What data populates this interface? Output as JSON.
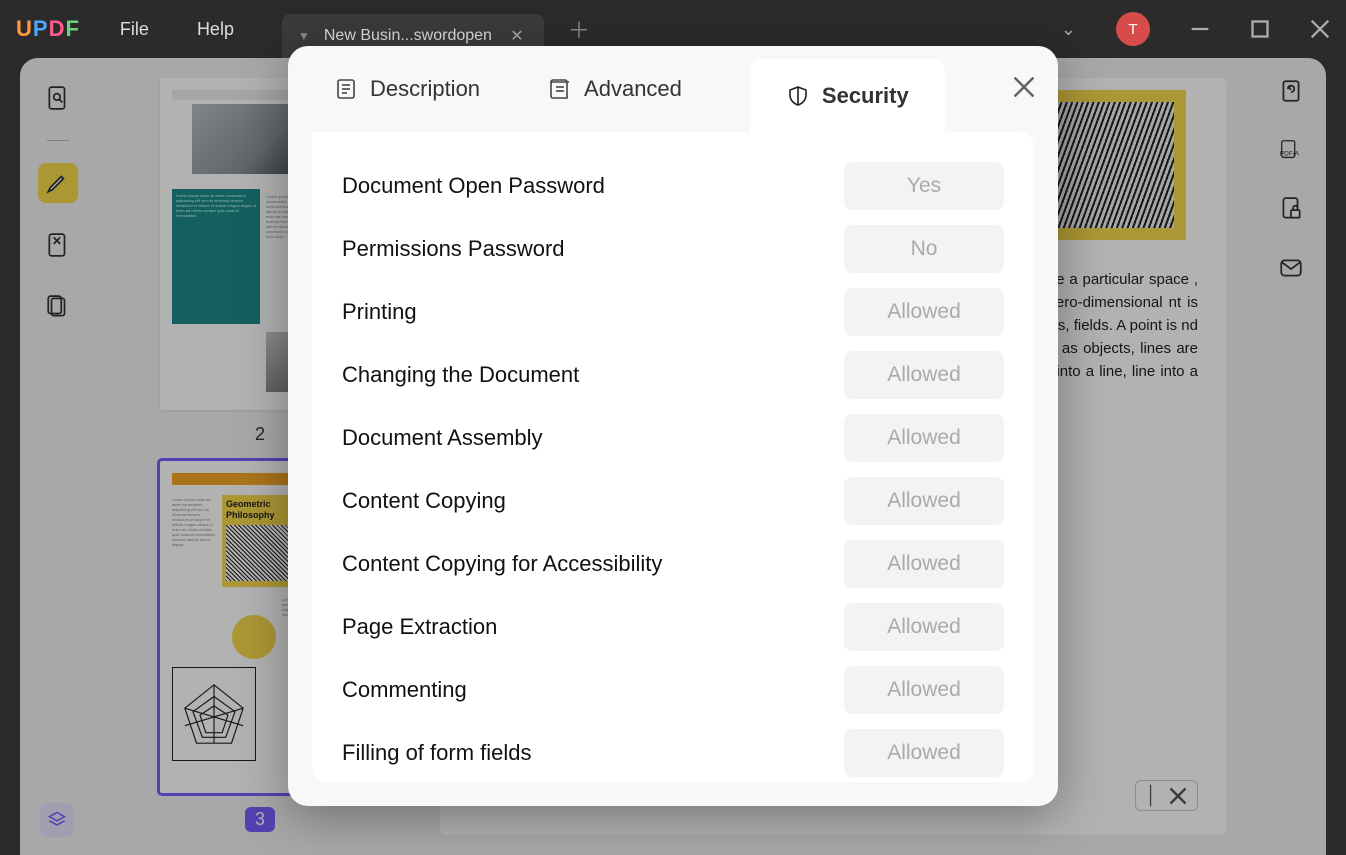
{
  "app": {
    "logo_U": "U",
    "logo_P": "P",
    "logo_D": "D",
    "logo_F": "F"
  },
  "menu": {
    "file": "File",
    "help": "Help"
  },
  "tab": {
    "title": "New Busin...swordopen"
  },
  "avatar_letter": "T",
  "thumbnails": {
    "page2_num": "2",
    "page3_num": "3",
    "page3_card_title": "Geometric Philosophy"
  },
  "doc_text": "…ogy, and related …ics , a point in a …be a particular space , in which of volume, area, -dimensional zero-dimensional nt is the simplest ally as the most metry, physics, fields. A point is nd a point is nt in geometry. In are regarded as objects, lines are ensional objects, regarded as two- ching into a line, line into a plane.",
  "modal": {
    "tabs": {
      "description": "Description",
      "advanced": "Advanced",
      "security": "Security"
    },
    "rows": [
      {
        "label": "Document Open Password",
        "value": "Yes"
      },
      {
        "label": "Permissions Password",
        "value": "No"
      },
      {
        "label": "Printing",
        "value": "Allowed"
      },
      {
        "label": "Changing the Document",
        "value": "Allowed"
      },
      {
        "label": "Document Assembly",
        "value": "Allowed"
      },
      {
        "label": "Content Copying",
        "value": "Allowed"
      },
      {
        "label": "Content Copying for Accessibility",
        "value": "Allowed"
      },
      {
        "label": "Page Extraction",
        "value": "Allowed"
      },
      {
        "label": "Commenting",
        "value": "Allowed"
      },
      {
        "label": "Filling of form fields",
        "value": "Allowed"
      }
    ]
  }
}
